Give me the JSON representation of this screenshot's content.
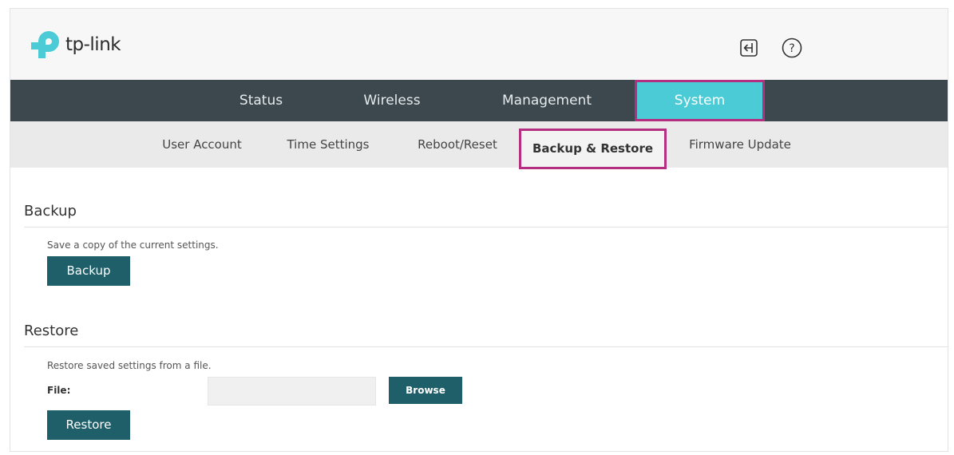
{
  "brand": {
    "name": "tp-link",
    "accent": "#4acbd6",
    "logo_color": "#4acbd6"
  },
  "header": {
    "icons": [
      "logout-icon",
      "help-icon"
    ]
  },
  "main_nav": {
    "tabs": [
      {
        "label": "Status"
      },
      {
        "label": "Wireless"
      },
      {
        "label": "Management"
      },
      {
        "label": "System",
        "selected": true
      }
    ]
  },
  "sub_nav": {
    "items": [
      {
        "label": "User Account"
      },
      {
        "label": "Time Settings"
      },
      {
        "label": "Reboot/Reset"
      },
      {
        "label": "Backup & Restore",
        "selected": true
      },
      {
        "label": "Firmware Update"
      }
    ]
  },
  "backup": {
    "title": "Backup",
    "description": "Save a copy of the current settings.",
    "button_label": "Backup"
  },
  "restore": {
    "title": "Restore",
    "description": "Restore saved settings from a file.",
    "file_label": "File:",
    "file_value": "",
    "browse_label": "Browse",
    "button_label": "Restore"
  },
  "colors": {
    "nav_bg": "#3c484d",
    "highlight_border": "#b52f80",
    "button_bg": "#1e5f69"
  }
}
